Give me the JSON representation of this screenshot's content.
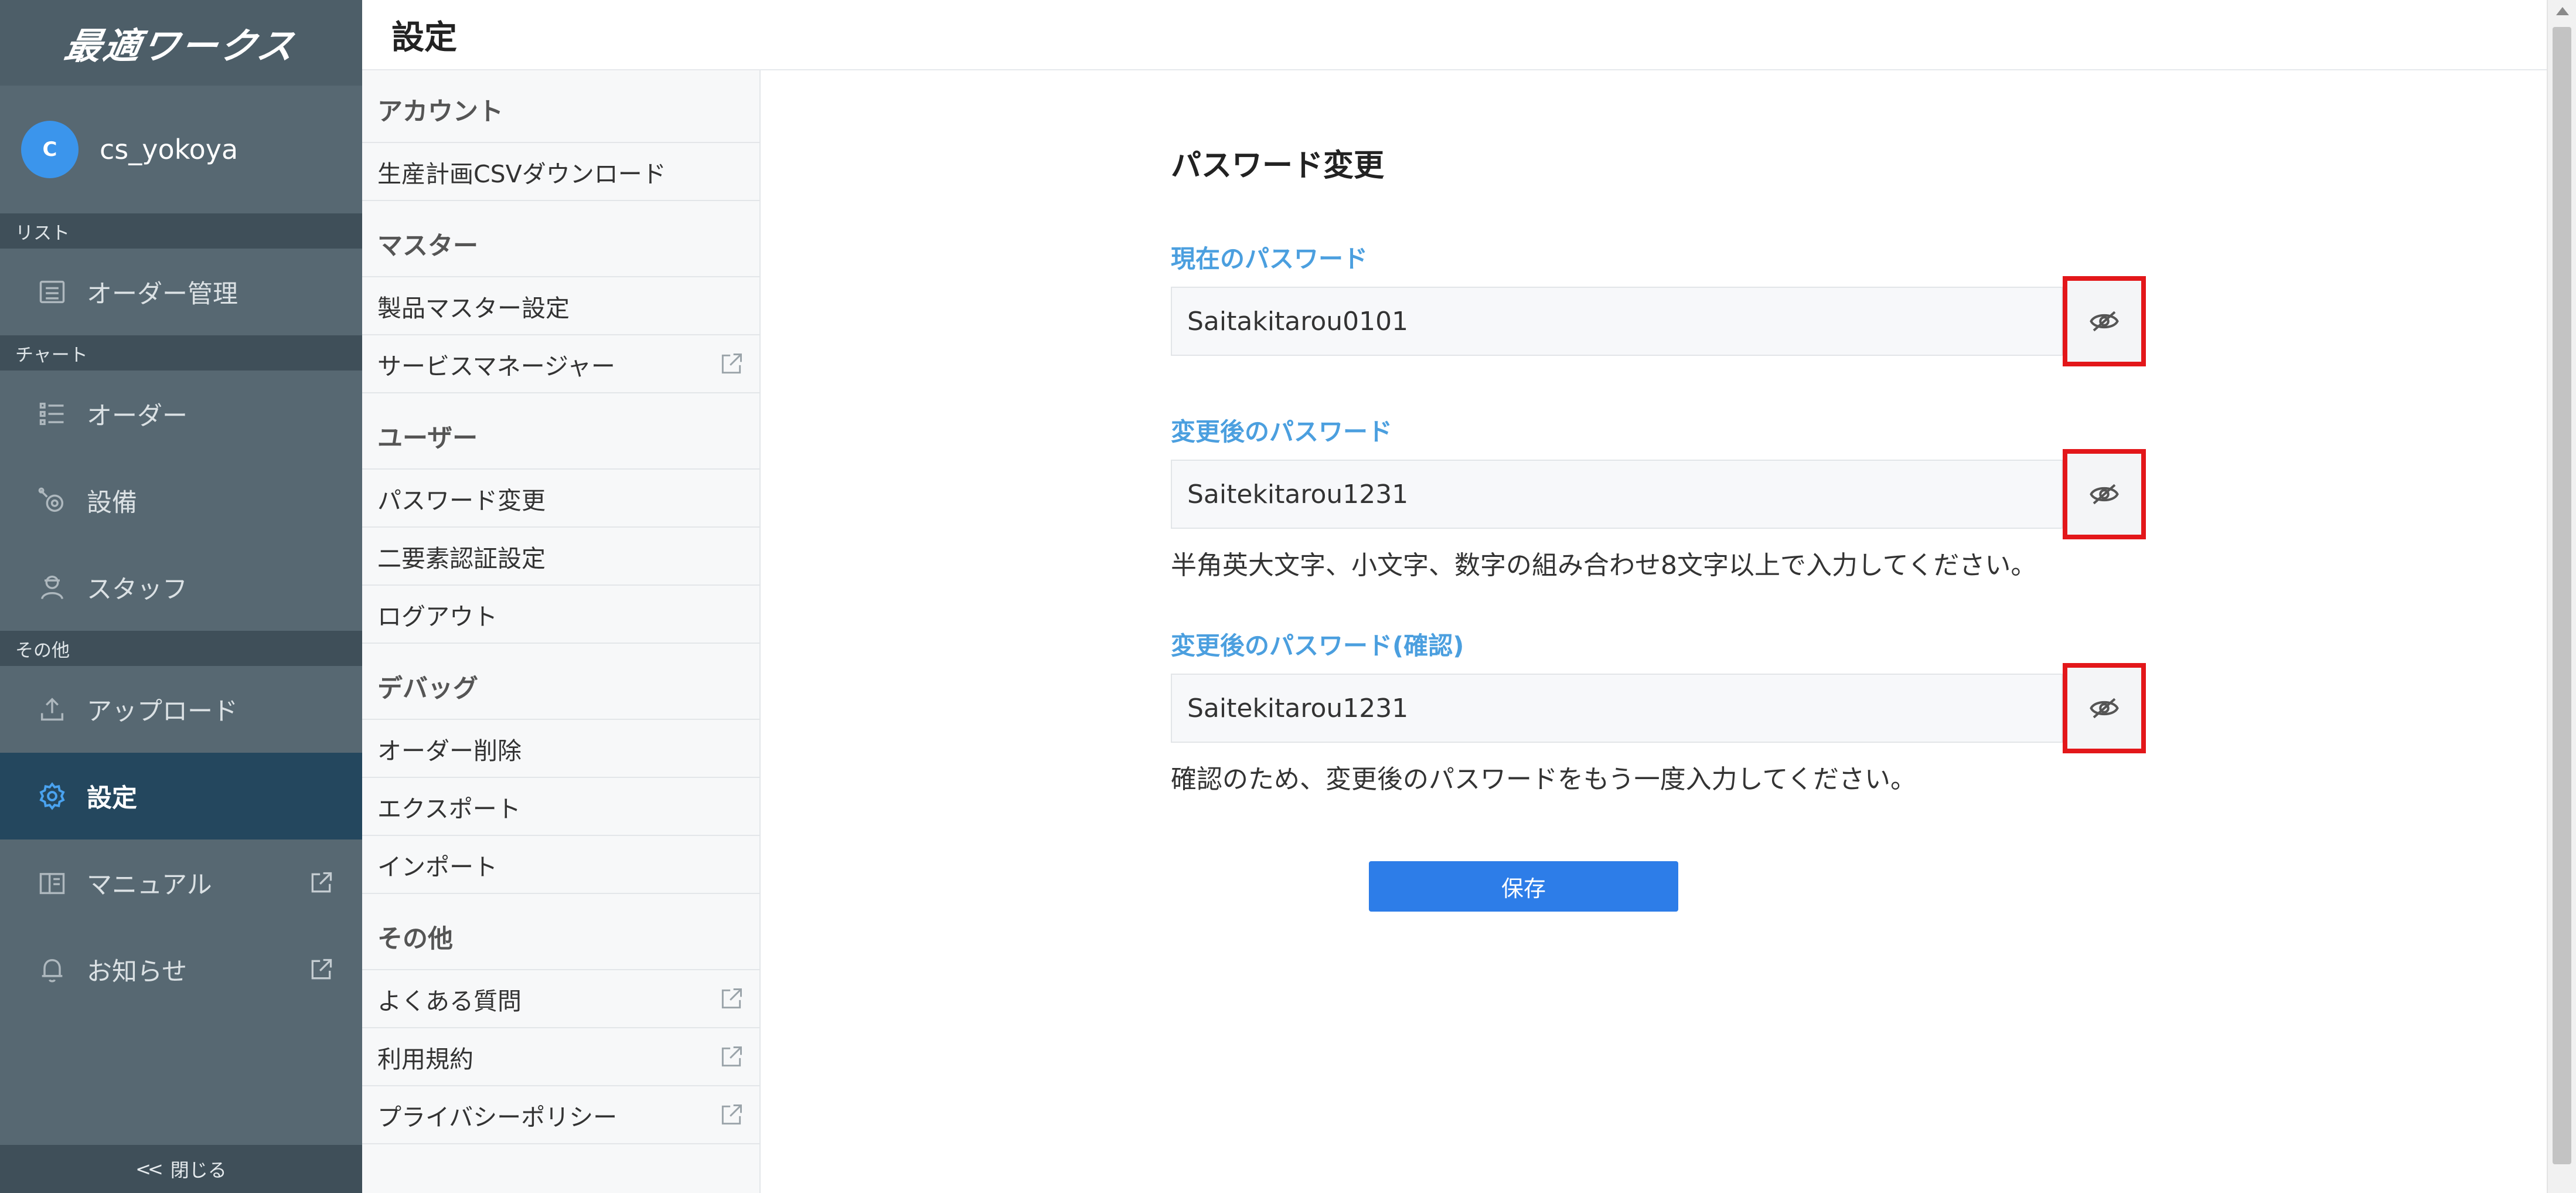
{
  "app": {
    "logo_text": "最適ワークス"
  },
  "user": {
    "avatar_initial": "C",
    "name": "cs_yokoya"
  },
  "sidebar": {
    "section_list": "リスト",
    "section_chart": "チャート",
    "section_other": "その他",
    "items": [
      {
        "label": "オーダー管理",
        "icon": "list-icon"
      },
      {
        "label": "オーダー",
        "icon": "bullet-list-icon"
      },
      {
        "label": "設備",
        "icon": "machine-gear-icon"
      },
      {
        "label": "スタッフ",
        "icon": "staff-person-icon"
      },
      {
        "label": "アップロード",
        "icon": "upload-icon"
      },
      {
        "label": "設定",
        "icon": "gear-icon",
        "active": true
      },
      {
        "label": "マニュアル",
        "icon": "book-icon",
        "external": true
      },
      {
        "label": "お知らせ",
        "icon": "bell-icon",
        "external": true
      }
    ],
    "close_label": "閉じる",
    "close_chevron": "<<"
  },
  "header": {
    "title": "設定"
  },
  "submenu": {
    "account": {
      "heading": "アカウント",
      "items": [
        "生産計画CSVダウンロード"
      ]
    },
    "master": {
      "heading": "マスター",
      "items": [
        "製品マスター設定",
        "サービスマネージャー"
      ]
    },
    "user": {
      "heading": "ユーザー",
      "items": [
        "パスワード変更",
        "二要素認証設定",
        "ログアウト"
      ]
    },
    "debug": {
      "heading": "デバッグ",
      "items": [
        "オーダー削除",
        "エクスポート",
        "インポート"
      ]
    },
    "other": {
      "heading": "その他",
      "items": [
        "よくある質問",
        "利用規約",
        "プライバシーポリシー"
      ]
    }
  },
  "form": {
    "title": "パスワード変更",
    "current": {
      "label": "現在のパスワード",
      "value": "Saitakitarou0101"
    },
    "new": {
      "label": "変更後のパスワード",
      "value": "Saitekitarou1231",
      "hint": "半角英大文字、小文字、数字の組み合わせ8文字以上で入力してください。"
    },
    "confirm": {
      "label": "変更後のパスワード(確認)",
      "value": "Saitekitarou1231",
      "hint": "確認のため、変更後のパスワードをもう一度入力してください。"
    },
    "save_label": "保存"
  },
  "colors": {
    "accent": "#2d7de8",
    "label_blue": "#4b9fdf",
    "highlight_red": "#e3171a",
    "sidebar_bg": "#576872",
    "sidebar_active": "#24475e"
  }
}
